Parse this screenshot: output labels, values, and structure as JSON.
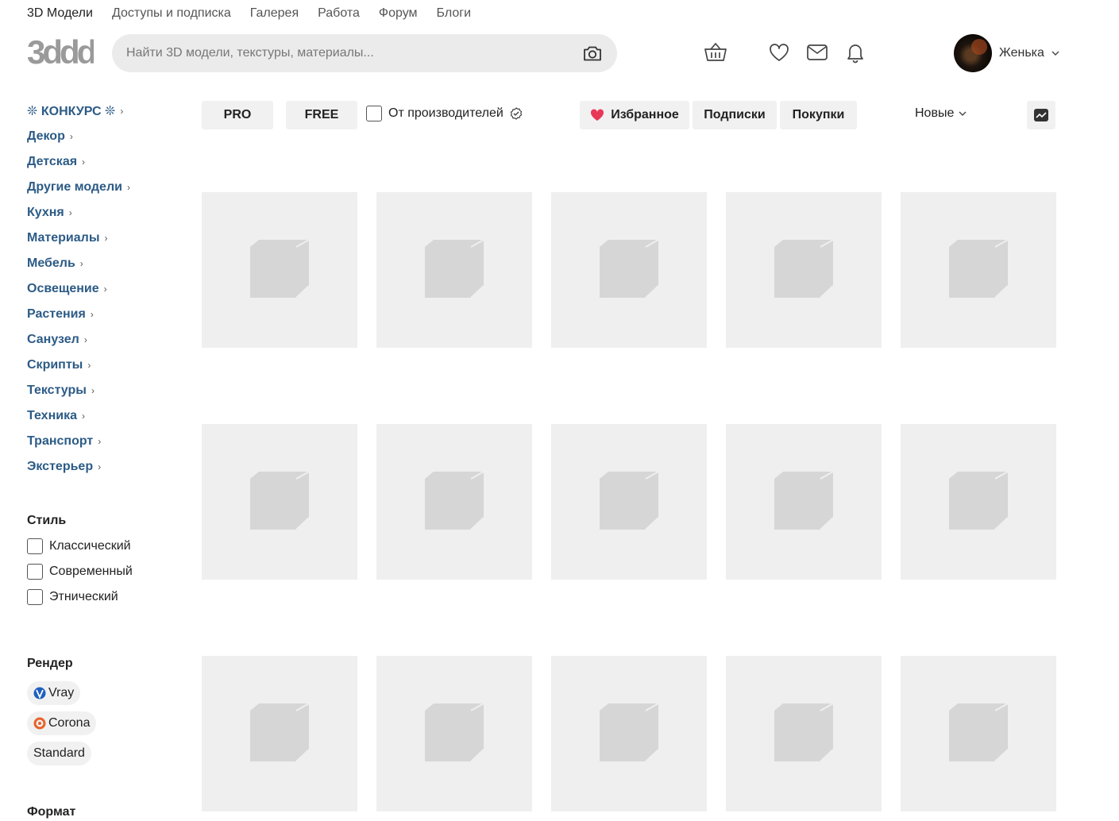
{
  "topnav": {
    "items": [
      "3D Модели",
      "Доступы и подписка",
      "Галерея",
      "Работа",
      "Форум",
      "Блоги"
    ]
  },
  "logo": {
    "text": "3ddd"
  },
  "search": {
    "placeholder": "Найти 3D модели, текстуры, материалы..."
  },
  "user": {
    "name": "Женька"
  },
  "categories": [
    "❊ КОНКУРС ❊",
    "Декор",
    "Детская",
    "Другие модели",
    "Кухня",
    "Материалы",
    "Мебель",
    "Освещение",
    "Растения",
    "Санузел",
    "Скрипты",
    "Текстуры",
    "Техника",
    "Транспорт",
    "Экстерьер"
  ],
  "style": {
    "title": "Стиль",
    "options": [
      "Классический",
      "Современный",
      "Этнический"
    ]
  },
  "render": {
    "title": "Рендер",
    "options": [
      "Vray",
      "Corona",
      "Standard"
    ]
  },
  "format": {
    "title": "Формат"
  },
  "filters": {
    "pro": "PRO",
    "free": "FREE",
    "maker": "От производителей",
    "favorites": "Избранное",
    "subscriptions": "Подписки",
    "purchases": "Покупки",
    "sort": "Новые"
  },
  "colors": {
    "link": "#2c5b86",
    "heart": "#e8385a",
    "placeholder_bg": "#efefef",
    "vray": "#1f5fbf",
    "corona": "#e8622a"
  }
}
